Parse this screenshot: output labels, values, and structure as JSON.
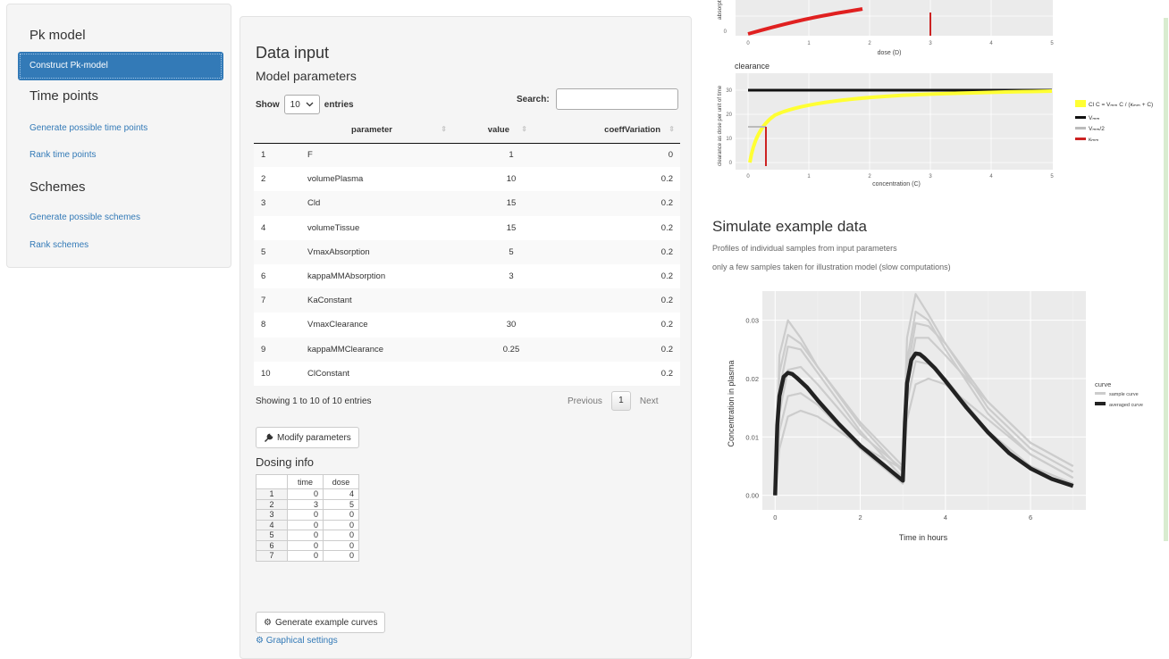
{
  "sidebar": {
    "sections": [
      "Pk model",
      "Time points",
      "Schemes"
    ],
    "active_item": "Construct Pk-model",
    "links": [
      "Generate possible time points",
      "Rank time points",
      "Generate possible schemes",
      "Rank schemes"
    ]
  },
  "main": {
    "title": "Data input",
    "subtitle": "Model parameters",
    "show_label": "Show",
    "show_value": "10",
    "entries_label": "entries",
    "search_label": "Search:",
    "columns": [
      "parameter",
      "value",
      "coeffVariation"
    ],
    "rows": [
      [
        "1",
        "F",
        "1",
        "0"
      ],
      [
        "2",
        "volumePlasma",
        "10",
        "0.2"
      ],
      [
        "3",
        "Cld",
        "15",
        "0.2"
      ],
      [
        "4",
        "volumeTissue",
        "15",
        "0.2"
      ],
      [
        "5",
        "VmaxAbsorption",
        "5",
        "0.2"
      ],
      [
        "6",
        "kappaMMAbsorption",
        "3",
        "0.2"
      ],
      [
        "7",
        "KaConstant",
        "",
        "0.2"
      ],
      [
        "8",
        "VmaxClearance",
        "30",
        "0.2"
      ],
      [
        "9",
        "kappaMMClearance",
        "0.25",
        "0.2"
      ],
      [
        "10",
        "ClConstant",
        "",
        "0.2"
      ]
    ],
    "info_text": "Showing 1 to 10 of 10 entries",
    "prev_label": "Previous",
    "page": "1",
    "next_label": "Next",
    "modify_button": "Modify parameters",
    "dosing_title": "Dosing info",
    "dosing_columns": [
      "time",
      "dose"
    ],
    "dosing_rows": [
      [
        "1",
        "0",
        "4"
      ],
      [
        "2",
        "3",
        "5"
      ],
      [
        "3",
        "0",
        "0"
      ],
      [
        "4",
        "0",
        "0"
      ],
      [
        "5",
        "0",
        "0"
      ],
      [
        "6",
        "0",
        "0"
      ],
      [
        "7",
        "0",
        "0"
      ]
    ],
    "generate_button": "Generate example curves",
    "graphical_link": "Graphical settings"
  },
  "colors": {
    "accent": "#337ab7",
    "yellow": "#ffff33",
    "red": "#dd2222",
    "dark": "#222222",
    "grey": "#cccccc"
  },
  "top_plot": {
    "ylabel": "absorptic",
    "xlabel": "dose (D)",
    "xticks": [
      "0",
      "1",
      "2",
      "3",
      "4",
      "5"
    ],
    "ytick": "0"
  },
  "clearance_plot": {
    "title": "clearance",
    "ylabel": "clearance as dose per unit of time",
    "xlabel": "concentration (C)",
    "xticks": [
      "0",
      "1",
      "2",
      "3",
      "4",
      "5"
    ],
    "yticks": [
      "30",
      "20",
      "10",
      "0"
    ],
    "legend": [
      "Cl C = Vₘₘ C / (κₘₘ + C)",
      "Vₘₘ",
      "Vₘₘ/2",
      "κₘₘ"
    ]
  },
  "simulate": {
    "title": "Simulate example data",
    "desc1": "Profiles of individual samples from input parameters",
    "desc2": "only a few samples taken for illustration model (slow computations)"
  },
  "chart_data": {
    "type": "line",
    "xlabel": "Time in hours",
    "ylabel": "Concentration in plasma",
    "xlim": [
      0,
      7
    ],
    "ylim": [
      0,
      0.035
    ],
    "xticks": [
      "0",
      "2",
      "4",
      "6"
    ],
    "yticks": [
      "0.00",
      "0.01",
      "0.02",
      "0.03"
    ],
    "grid": true,
    "legend_title": "curve",
    "legend_position": "right",
    "legend": [
      "sample curve",
      "averaged curve"
    ],
    "series": [
      {
        "name": "averaged curve",
        "x": [
          0,
          0.05,
          0.1,
          0.2,
          0.3,
          0.4,
          0.5,
          0.75,
          1,
          1.5,
          2,
          2.5,
          3,
          3.05,
          3.1,
          3.2,
          3.3,
          3.4,
          3.5,
          3.75,
          4,
          4.5,
          5,
          5.5,
          6,
          6.5,
          7
        ],
        "y": [
          0,
          0.012,
          0.017,
          0.0203,
          0.021,
          0.0208,
          0.0202,
          0.0185,
          0.0163,
          0.0122,
          0.0085,
          0.0055,
          0.0025,
          0.0125,
          0.0192,
          0.0232,
          0.0243,
          0.0242,
          0.0236,
          0.0218,
          0.0196,
          0.015,
          0.0108,
          0.0072,
          0.0046,
          0.0028,
          0.0016
        ]
      },
      {
        "name": "sample curve",
        "x": [
          0,
          0.1,
          0.3,
          0.6,
          1,
          2,
          3,
          3.1,
          3.3,
          3.6,
          4,
          5,
          6,
          7
        ],
        "y": [
          0,
          0.024,
          0.03,
          0.027,
          0.022,
          0.012,
          0.004,
          0.027,
          0.0345,
          0.031,
          0.026,
          0.015,
          0.008,
          0.004
        ]
      },
      {
        "name": "sample curve",
        "x": [
          0,
          0.1,
          0.3,
          0.6,
          1,
          2,
          3,
          3.1,
          3.3,
          3.6,
          4,
          5,
          6,
          7
        ],
        "y": [
          0,
          0.018,
          0.0255,
          0.025,
          0.021,
          0.011,
          0.003,
          0.023,
          0.0315,
          0.03,
          0.025,
          0.014,
          0.007,
          0.003
        ]
      },
      {
        "name": "sample curve",
        "x": [
          0,
          0.1,
          0.3,
          0.6,
          1,
          2,
          3,
          3.1,
          3.3,
          3.6,
          4,
          5,
          6,
          7
        ],
        "y": [
          0,
          0.014,
          0.0215,
          0.022,
          0.019,
          0.0105,
          0.0045,
          0.019,
          0.027,
          0.027,
          0.024,
          0.016,
          0.009,
          0.005
        ]
      },
      {
        "name": "sample curve",
        "x": [
          0,
          0.1,
          0.3,
          0.6,
          1,
          2,
          3,
          3.1,
          3.3,
          3.6,
          4,
          5,
          6,
          7
        ],
        "y": [
          0,
          0.011,
          0.017,
          0.0175,
          0.0155,
          0.008,
          0.002,
          0.016,
          0.023,
          0.0225,
          0.02,
          0.011,
          0.005,
          0.002
        ]
      },
      {
        "name": "sample curve",
        "x": [
          0,
          0.1,
          0.3,
          0.6,
          1,
          2,
          3,
          3.1,
          3.3,
          3.6,
          4,
          5,
          6,
          7
        ],
        "y": [
          0,
          0.008,
          0.0135,
          0.0145,
          0.0135,
          0.0085,
          0.0045,
          0.013,
          0.019,
          0.02,
          0.019,
          0.013,
          0.007,
          0.003
        ]
      },
      {
        "name": "sample curve",
        "x": [
          0,
          0.1,
          0.3,
          0.6,
          1,
          2,
          3,
          3.1,
          3.3,
          3.6,
          4,
          5,
          6,
          7
        ],
        "y": [
          0,
          0.021,
          0.0275,
          0.026,
          0.022,
          0.0125,
          0.005,
          0.021,
          0.0295,
          0.029,
          0.026,
          0.016,
          0.009,
          0.005
        ]
      }
    ]
  }
}
